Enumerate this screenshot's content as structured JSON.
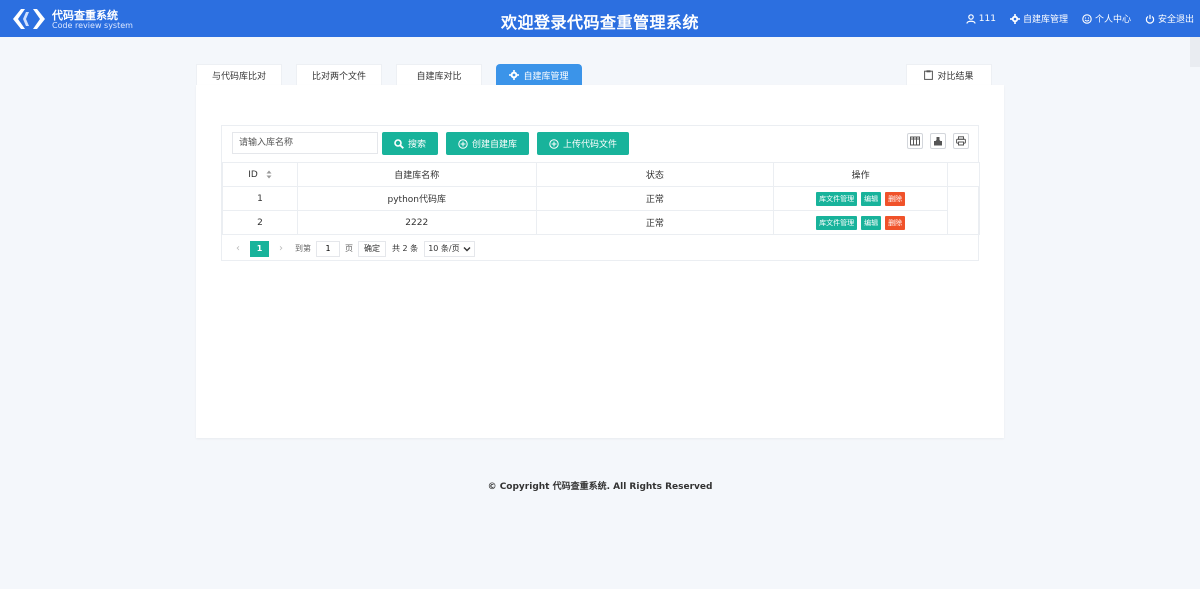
{
  "header": {
    "brand_name": "代码查重系统",
    "brand_sub": "Code review system",
    "title": "欢迎登录代码查重管理系统",
    "user": "111",
    "repo_manage": "自建库管理",
    "personal_center": "个人中心",
    "logout": "安全退出"
  },
  "tabs": [
    {
      "label": "与代码库比对"
    },
    {
      "label": "比对两个文件"
    },
    {
      "label": "自建库对比"
    },
    {
      "label": "自建库管理"
    },
    {
      "label": "对比结果"
    }
  ],
  "toolbar": {
    "search_placeholder": "请输入库名称",
    "search_label": "搜索",
    "create_label": "创建自建库",
    "upload_label": "上传代码文件"
  },
  "table": {
    "columns": [
      "ID",
      "自建库名称",
      "状态",
      "操作"
    ],
    "rows": [
      {
        "id": "1",
        "name": "python代码库",
        "status": "正常"
      },
      {
        "id": "2",
        "name": "2222",
        "status": "正常"
      }
    ],
    "actions": {
      "manage": "库文件管理",
      "edit": "编辑",
      "delete": "删除"
    }
  },
  "pager": {
    "current": "1",
    "goto_label": "到第",
    "goto_value": "1",
    "page_label": "页",
    "confirm": "确定",
    "total": "共 2 条",
    "page_size": "10 条/页"
  },
  "footer": {
    "copyright": "© Copyright 代码查重系统. All Rights Reserved"
  },
  "colors": {
    "header": "#2c6fe0",
    "tab_active": "#3b94e9",
    "teal": "#18b39b",
    "danger": "#f0522a"
  }
}
